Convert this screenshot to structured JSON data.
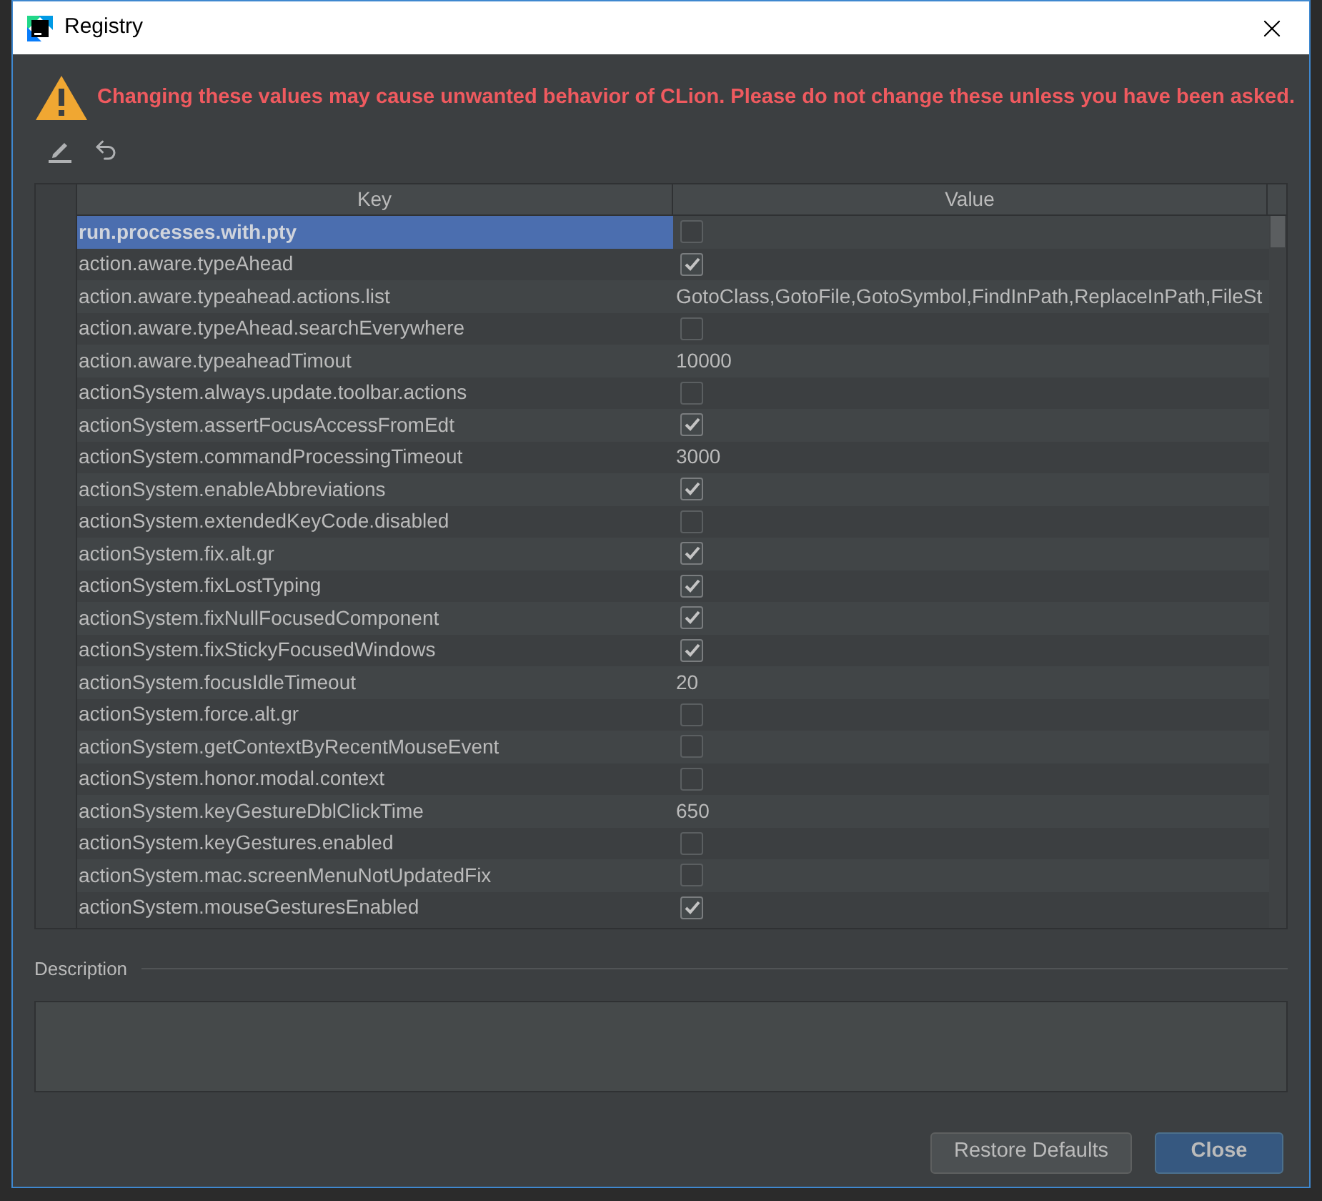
{
  "window": {
    "title": "Registry"
  },
  "warning": "Changing these values may cause unwanted behavior of CLion. Please do not change these unless you have been asked.",
  "table": {
    "columns": [
      "Key",
      "Value"
    ],
    "rows": [
      {
        "key": "run.processes.with.pty",
        "kind": "checkbox",
        "checked": false,
        "selected": true
      },
      {
        "key": "action.aware.typeAhead",
        "kind": "checkbox",
        "checked": true,
        "selected": false
      },
      {
        "key": "action.aware.typeahead.actions.list",
        "kind": "text",
        "value": "GotoClass,GotoFile,GotoSymbol,FindInPath,ReplaceInPath,FileSt",
        "selected": false
      },
      {
        "key": "action.aware.typeAhead.searchEverywhere",
        "kind": "checkbox",
        "checked": false,
        "selected": false
      },
      {
        "key": "action.aware.typeaheadTimout",
        "kind": "text",
        "value": "10000",
        "selected": false
      },
      {
        "key": "actionSystem.always.update.toolbar.actions",
        "kind": "checkbox",
        "checked": false,
        "selected": false
      },
      {
        "key": "actionSystem.assertFocusAccessFromEdt",
        "kind": "checkbox",
        "checked": true,
        "selected": false
      },
      {
        "key": "actionSystem.commandProcessingTimeout",
        "kind": "text",
        "value": "3000",
        "selected": false
      },
      {
        "key": "actionSystem.enableAbbreviations",
        "kind": "checkbox",
        "checked": true,
        "selected": false
      },
      {
        "key": "actionSystem.extendedKeyCode.disabled",
        "kind": "checkbox",
        "checked": false,
        "selected": false
      },
      {
        "key": "actionSystem.fix.alt.gr",
        "kind": "checkbox",
        "checked": true,
        "selected": false
      },
      {
        "key": "actionSystem.fixLostTyping",
        "kind": "checkbox",
        "checked": true,
        "selected": false
      },
      {
        "key": "actionSystem.fixNullFocusedComponent",
        "kind": "checkbox",
        "checked": true,
        "selected": false
      },
      {
        "key": "actionSystem.fixStickyFocusedWindows",
        "kind": "checkbox",
        "checked": true,
        "selected": false
      },
      {
        "key": "actionSystem.focusIdleTimeout",
        "kind": "text",
        "value": "20",
        "selected": false
      },
      {
        "key": "actionSystem.force.alt.gr",
        "kind": "checkbox",
        "checked": false,
        "selected": false
      },
      {
        "key": "actionSystem.getContextByRecentMouseEvent",
        "kind": "checkbox",
        "checked": false,
        "selected": false
      },
      {
        "key": "actionSystem.honor.modal.context",
        "kind": "checkbox",
        "checked": false,
        "selected": false
      },
      {
        "key": "actionSystem.keyGestureDblClickTime",
        "kind": "text",
        "value": "650",
        "selected": false
      },
      {
        "key": "actionSystem.keyGestures.enabled",
        "kind": "checkbox",
        "checked": false,
        "selected": false
      },
      {
        "key": "actionSystem.mac.screenMenuNotUpdatedFix",
        "kind": "checkbox",
        "checked": false,
        "selected": false
      },
      {
        "key": "actionSystem.mouseGesturesEnabled",
        "kind": "checkbox",
        "checked": true,
        "selected": false
      }
    ]
  },
  "description": {
    "label": "Description"
  },
  "buttons": [
    "Restore Defaults",
    "Close"
  ]
}
